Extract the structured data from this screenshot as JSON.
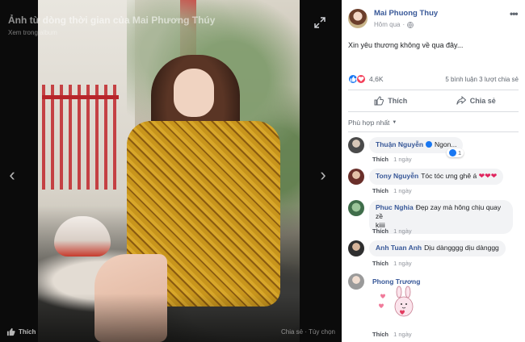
{
  "viewer": {
    "title": "Ảnh từ dòng thời gian của Mai Phương Thúy",
    "subtitle": "Xem trong album",
    "like_label": "Thích",
    "right_text": "Chia sẻ · Tùy chọn"
  },
  "post": {
    "author": "Mai Phuong Thuy",
    "time": "Hôm qua",
    "text": "Xin yêu thương không về qua đây...",
    "reaction_count": "4,6K",
    "comments_count": "5 bình luận",
    "shares_count": "3 lượt chia sẻ",
    "like_button": "Thích",
    "share_button": "Chia sẻ",
    "sort_label": "Phù hợp nhất"
  },
  "comments": [
    {
      "name": "Thuận Nguyễn",
      "text": "Ngon...",
      "reacts": "1",
      "like": "Thích",
      "time": "1 ngày"
    },
    {
      "name": "Tony Nguyễn",
      "text": "Tóc tóc ưng ghê á",
      "hearts": "❤❤❤",
      "like": "Thích",
      "time": "1 ngày"
    },
    {
      "name": "Phuc Nghia",
      "text": "Đẹp zay mà hông chịu quay zề",
      "text2": "kiiii",
      "like": "Thích",
      "time": "1 ngày"
    },
    {
      "name": "Anh Tuan Anh",
      "text": "Dịu dàngggg dịu dànggg",
      "like": "Thích",
      "time": "1 ngày"
    },
    {
      "name": "Phong Trương",
      "like": "Thích",
      "time": "1 ngày"
    }
  ],
  "colors": {
    "link": "#385898",
    "like_blue": "#1877f2",
    "love_red": "#f33e58"
  }
}
